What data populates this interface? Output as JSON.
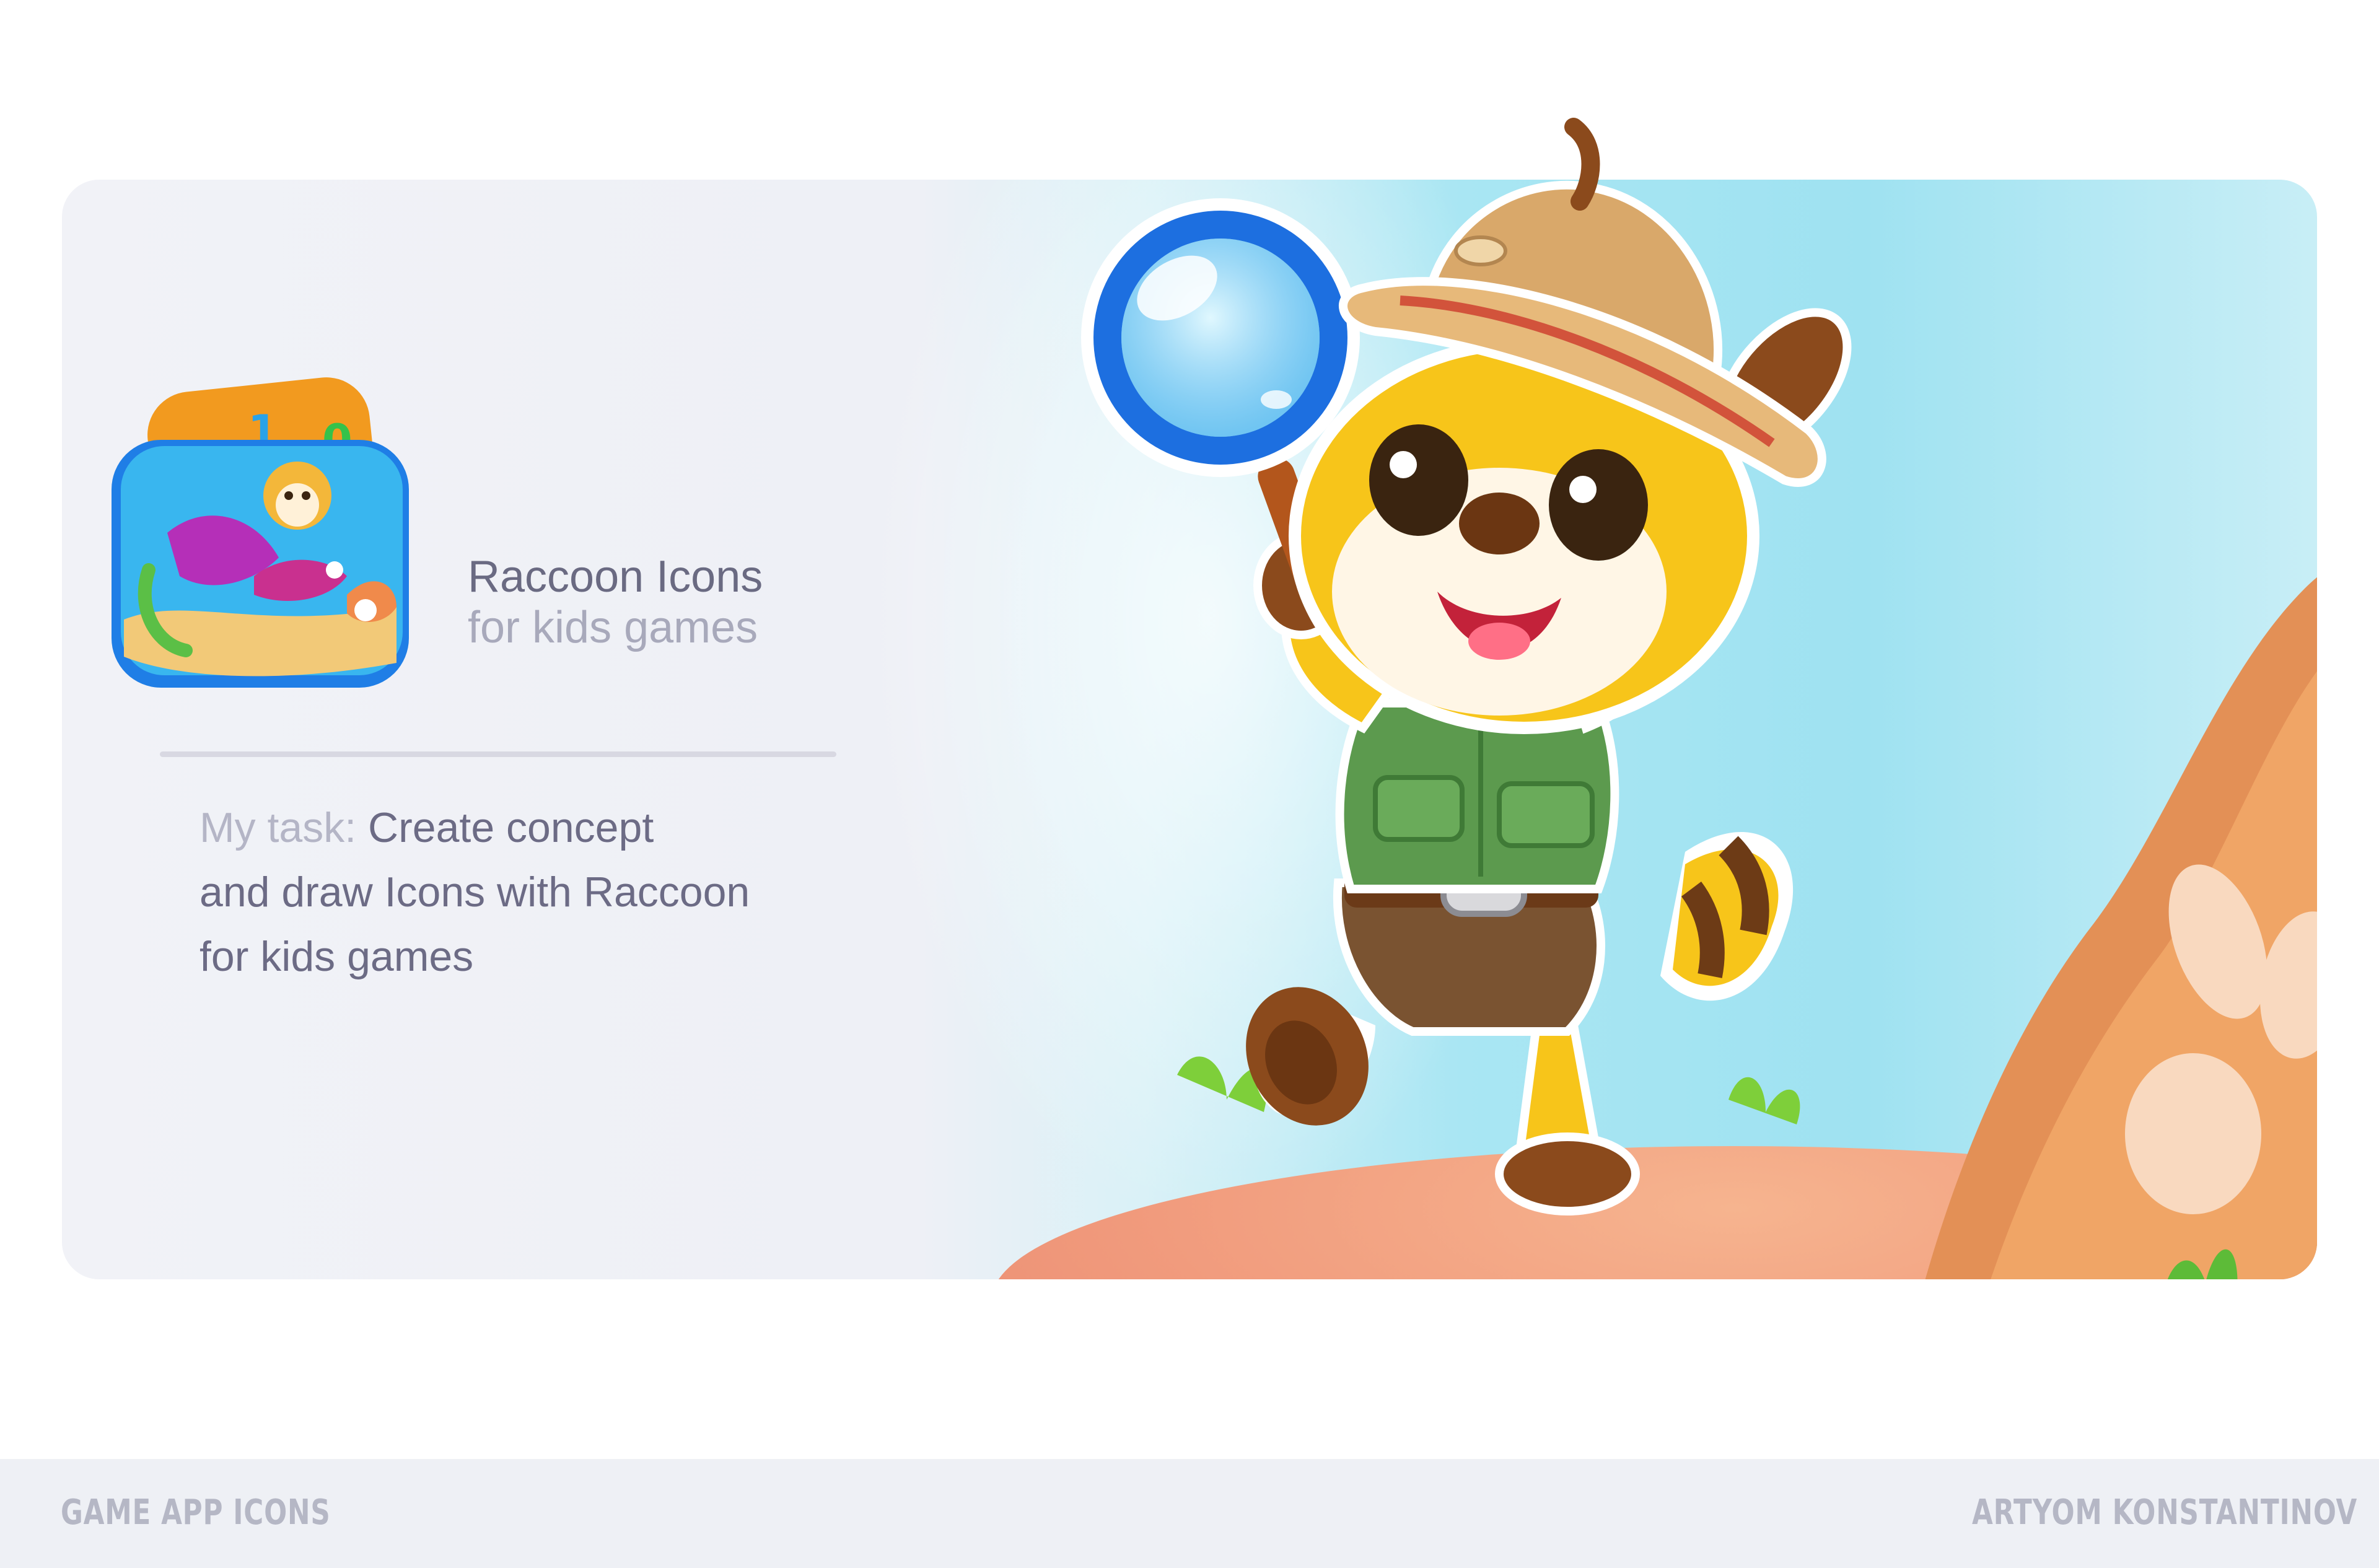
{
  "card": {
    "title": "Raccoon Icons",
    "subtitle": "for kids games",
    "task": {
      "label": "My task:",
      "line1": "Create concept",
      "line2": "and draw Icons with Raccoon",
      "line3": "for kids games"
    }
  },
  "footer": {
    "left": "GAME APP ICONS",
    "right": "ARTYOM KONSTANTINOV"
  },
  "illustration": {
    "icon_digit": "1",
    "icon_letter": "0"
  },
  "colors": {
    "sky": "#9fe2f1",
    "ground": "#f19b7d",
    "raccoon_yellow": "#f7c51a",
    "shirt_green": "#5c9a4e",
    "hat_tan": "#d9a86a",
    "magnifier_blue": "#1d6fe0",
    "text_primary": "#6a6a82",
    "text_muted": "#a8a9bb"
  }
}
